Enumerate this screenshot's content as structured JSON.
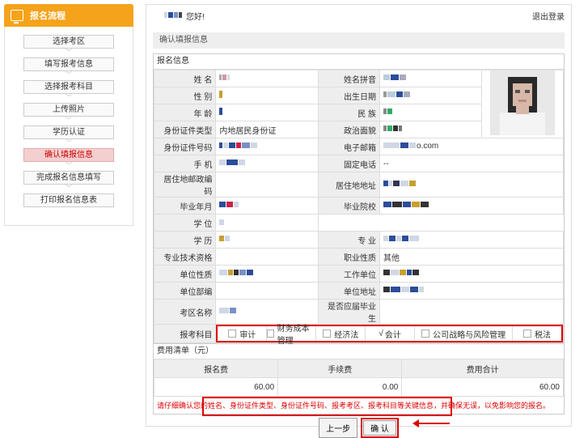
{
  "sidebar": {
    "title": "报名流程",
    "steps": [
      "选择考区",
      "填写报考信息",
      "选择报考科目",
      "上传照片",
      "学历认证",
      "确认填报信息",
      "完成报名信息填写",
      "打印报名信息表"
    ],
    "active_index": 5
  },
  "header": {
    "greeting": "您好!",
    "logout": "退出登录"
  },
  "section_title": "确认填报信息",
  "info": {
    "title": "报名信息",
    "labels": {
      "name": "姓 名",
      "pinyin": "姓名拼音",
      "gender": "性 别",
      "birth": "出生日期",
      "age": "年 龄",
      "ethnicity": "民 族",
      "id_type": "身份证件类型",
      "political": "政治面貌",
      "id_no": "身份证件号码",
      "email": "电子邮箱",
      "phone": "手 机",
      "tel": "固定电话",
      "postcode": "居住地邮政编码",
      "address": "居住地地址",
      "grad_date": "毕业年月",
      "school": "毕业院校",
      "degree": "学 位",
      "education": "学 历",
      "major": "专 业",
      "tech_title": "专业技术资格",
      "job_type": "职业性质",
      "unit_type": "单位性质",
      "unit": "工作单位",
      "dept": "单位部编",
      "unit_addr": "单位地址",
      "area": "考区名称",
      "is_grad": "是否应届毕业生",
      "subjects": "报考科目"
    },
    "values": {
      "id_type": "内地居民身份证",
      "email_suffix": "o.com",
      "tel": "--",
      "job_type": "其他"
    }
  },
  "subjects": [
    {
      "label": "审计",
      "checked": false
    },
    {
      "label": "财务成本管理",
      "checked": false
    },
    {
      "label": "经济法",
      "checked": false
    },
    {
      "label": "会计",
      "checked": true
    },
    {
      "label": "公司战略与风险管理",
      "checked": false
    },
    {
      "label": "税法",
      "checked": false
    }
  ],
  "fees": {
    "title": "费用清单（元）",
    "headers": [
      "报名费",
      "手续费",
      "费用合计"
    ],
    "values": [
      "60.00",
      "0.00",
      "60.00"
    ]
  },
  "notice": "请仔细确认您的姓名、身份证件类型、身份证件号码、报考考区、报考科目等关键信息，并确保无误，以免影响您的报名。",
  "buttons": {
    "prev": "上一步",
    "confirm": "确 认"
  },
  "colors": {
    "accent": "#f5a31a",
    "highlight": "#dd0000",
    "active_step_bg": "#f4cfcf"
  }
}
